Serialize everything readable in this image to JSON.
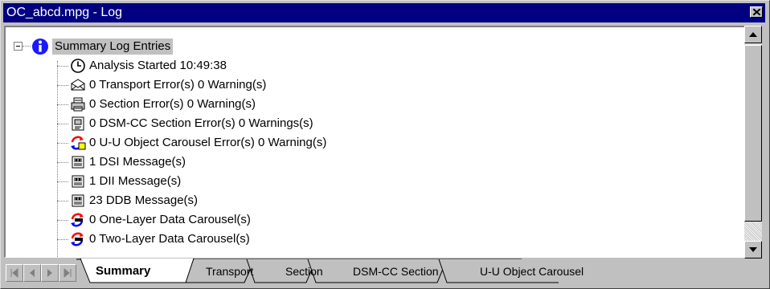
{
  "window": {
    "title": "OC_abcd.mpg - Log"
  },
  "tree": {
    "root_label": "Summary Log Entries",
    "items": [
      {
        "label": "Analysis Started 10:49:38",
        "icon": "clock-icon"
      },
      {
        "label": "0 Transport Error(s) 0 Warning(s)",
        "icon": "envelope-icon"
      },
      {
        "label": "0 Section Error(s) 0 Warning(s)",
        "icon": "printer-icon"
      },
      {
        "label": "0 DSM-CC Section Error(s) 0 Warnings(s)",
        "icon": "document-icon"
      },
      {
        "label": "0 U-U Object Carousel Error(s) 0 Warning(s)",
        "icon": "carousel-icon"
      },
      {
        "label": "1 DSI Message(s)",
        "icon": "message-icon"
      },
      {
        "label": "1 DII Message(s)",
        "icon": "message-icon"
      },
      {
        "label": "23 DDB Message(s)",
        "icon": "message-icon"
      },
      {
        "label": "0 One-Layer Data Carousel(s)",
        "icon": "data-carousel-icon"
      },
      {
        "label": "0 Two-Layer Data Carousel(s)",
        "icon": "data-carousel-icon"
      }
    ]
  },
  "tabs": [
    "Summary",
    "Transport",
    "Section",
    "DSM-CC Section",
    "U-U Object Carousel"
  ],
  "active_tab": "Summary",
  "colors": {
    "titlebar": "#000080",
    "face": "#c0c0c0",
    "info_icon": "#1a1aff"
  }
}
